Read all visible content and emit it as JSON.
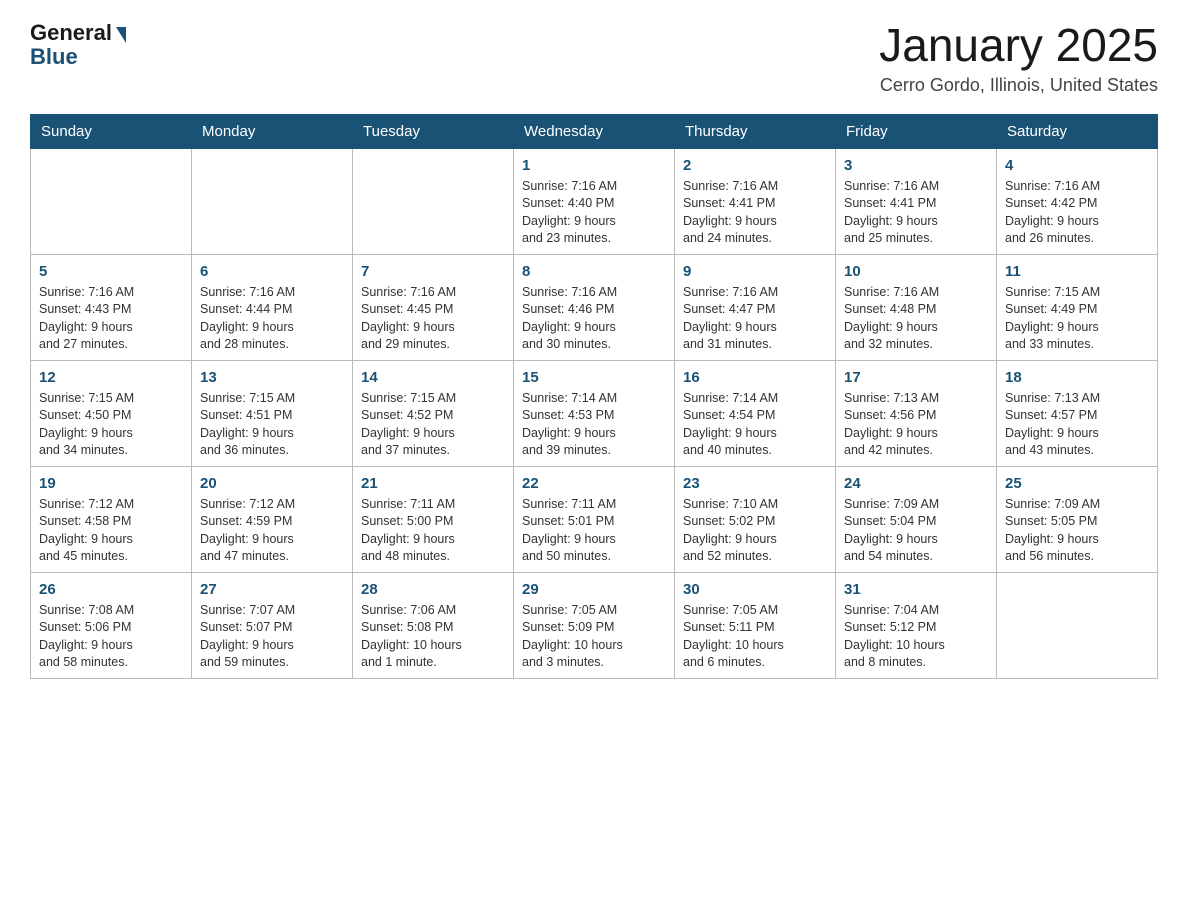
{
  "logo": {
    "general": "General",
    "blue": "Blue"
  },
  "header": {
    "month": "January 2025",
    "location": "Cerro Gordo, Illinois, United States"
  },
  "days_of_week": [
    "Sunday",
    "Monday",
    "Tuesday",
    "Wednesday",
    "Thursday",
    "Friday",
    "Saturday"
  ],
  "weeks": [
    [
      {
        "day": "",
        "info": ""
      },
      {
        "day": "",
        "info": ""
      },
      {
        "day": "",
        "info": ""
      },
      {
        "day": "1",
        "info": "Sunrise: 7:16 AM\nSunset: 4:40 PM\nDaylight: 9 hours\nand 23 minutes."
      },
      {
        "day": "2",
        "info": "Sunrise: 7:16 AM\nSunset: 4:41 PM\nDaylight: 9 hours\nand 24 minutes."
      },
      {
        "day": "3",
        "info": "Sunrise: 7:16 AM\nSunset: 4:41 PM\nDaylight: 9 hours\nand 25 minutes."
      },
      {
        "day": "4",
        "info": "Sunrise: 7:16 AM\nSunset: 4:42 PM\nDaylight: 9 hours\nand 26 minutes."
      }
    ],
    [
      {
        "day": "5",
        "info": "Sunrise: 7:16 AM\nSunset: 4:43 PM\nDaylight: 9 hours\nand 27 minutes."
      },
      {
        "day": "6",
        "info": "Sunrise: 7:16 AM\nSunset: 4:44 PM\nDaylight: 9 hours\nand 28 minutes."
      },
      {
        "day": "7",
        "info": "Sunrise: 7:16 AM\nSunset: 4:45 PM\nDaylight: 9 hours\nand 29 minutes."
      },
      {
        "day": "8",
        "info": "Sunrise: 7:16 AM\nSunset: 4:46 PM\nDaylight: 9 hours\nand 30 minutes."
      },
      {
        "day": "9",
        "info": "Sunrise: 7:16 AM\nSunset: 4:47 PM\nDaylight: 9 hours\nand 31 minutes."
      },
      {
        "day": "10",
        "info": "Sunrise: 7:16 AM\nSunset: 4:48 PM\nDaylight: 9 hours\nand 32 minutes."
      },
      {
        "day": "11",
        "info": "Sunrise: 7:15 AM\nSunset: 4:49 PM\nDaylight: 9 hours\nand 33 minutes."
      }
    ],
    [
      {
        "day": "12",
        "info": "Sunrise: 7:15 AM\nSunset: 4:50 PM\nDaylight: 9 hours\nand 34 minutes."
      },
      {
        "day": "13",
        "info": "Sunrise: 7:15 AM\nSunset: 4:51 PM\nDaylight: 9 hours\nand 36 minutes."
      },
      {
        "day": "14",
        "info": "Sunrise: 7:15 AM\nSunset: 4:52 PM\nDaylight: 9 hours\nand 37 minutes."
      },
      {
        "day": "15",
        "info": "Sunrise: 7:14 AM\nSunset: 4:53 PM\nDaylight: 9 hours\nand 39 minutes."
      },
      {
        "day": "16",
        "info": "Sunrise: 7:14 AM\nSunset: 4:54 PM\nDaylight: 9 hours\nand 40 minutes."
      },
      {
        "day": "17",
        "info": "Sunrise: 7:13 AM\nSunset: 4:56 PM\nDaylight: 9 hours\nand 42 minutes."
      },
      {
        "day": "18",
        "info": "Sunrise: 7:13 AM\nSunset: 4:57 PM\nDaylight: 9 hours\nand 43 minutes."
      }
    ],
    [
      {
        "day": "19",
        "info": "Sunrise: 7:12 AM\nSunset: 4:58 PM\nDaylight: 9 hours\nand 45 minutes."
      },
      {
        "day": "20",
        "info": "Sunrise: 7:12 AM\nSunset: 4:59 PM\nDaylight: 9 hours\nand 47 minutes."
      },
      {
        "day": "21",
        "info": "Sunrise: 7:11 AM\nSunset: 5:00 PM\nDaylight: 9 hours\nand 48 minutes."
      },
      {
        "day": "22",
        "info": "Sunrise: 7:11 AM\nSunset: 5:01 PM\nDaylight: 9 hours\nand 50 minutes."
      },
      {
        "day": "23",
        "info": "Sunrise: 7:10 AM\nSunset: 5:02 PM\nDaylight: 9 hours\nand 52 minutes."
      },
      {
        "day": "24",
        "info": "Sunrise: 7:09 AM\nSunset: 5:04 PM\nDaylight: 9 hours\nand 54 minutes."
      },
      {
        "day": "25",
        "info": "Sunrise: 7:09 AM\nSunset: 5:05 PM\nDaylight: 9 hours\nand 56 minutes."
      }
    ],
    [
      {
        "day": "26",
        "info": "Sunrise: 7:08 AM\nSunset: 5:06 PM\nDaylight: 9 hours\nand 58 minutes."
      },
      {
        "day": "27",
        "info": "Sunrise: 7:07 AM\nSunset: 5:07 PM\nDaylight: 9 hours\nand 59 minutes."
      },
      {
        "day": "28",
        "info": "Sunrise: 7:06 AM\nSunset: 5:08 PM\nDaylight: 10 hours\nand 1 minute."
      },
      {
        "day": "29",
        "info": "Sunrise: 7:05 AM\nSunset: 5:09 PM\nDaylight: 10 hours\nand 3 minutes."
      },
      {
        "day": "30",
        "info": "Sunrise: 7:05 AM\nSunset: 5:11 PM\nDaylight: 10 hours\nand 6 minutes."
      },
      {
        "day": "31",
        "info": "Sunrise: 7:04 AM\nSunset: 5:12 PM\nDaylight: 10 hours\nand 8 minutes."
      },
      {
        "day": "",
        "info": ""
      }
    ]
  ]
}
